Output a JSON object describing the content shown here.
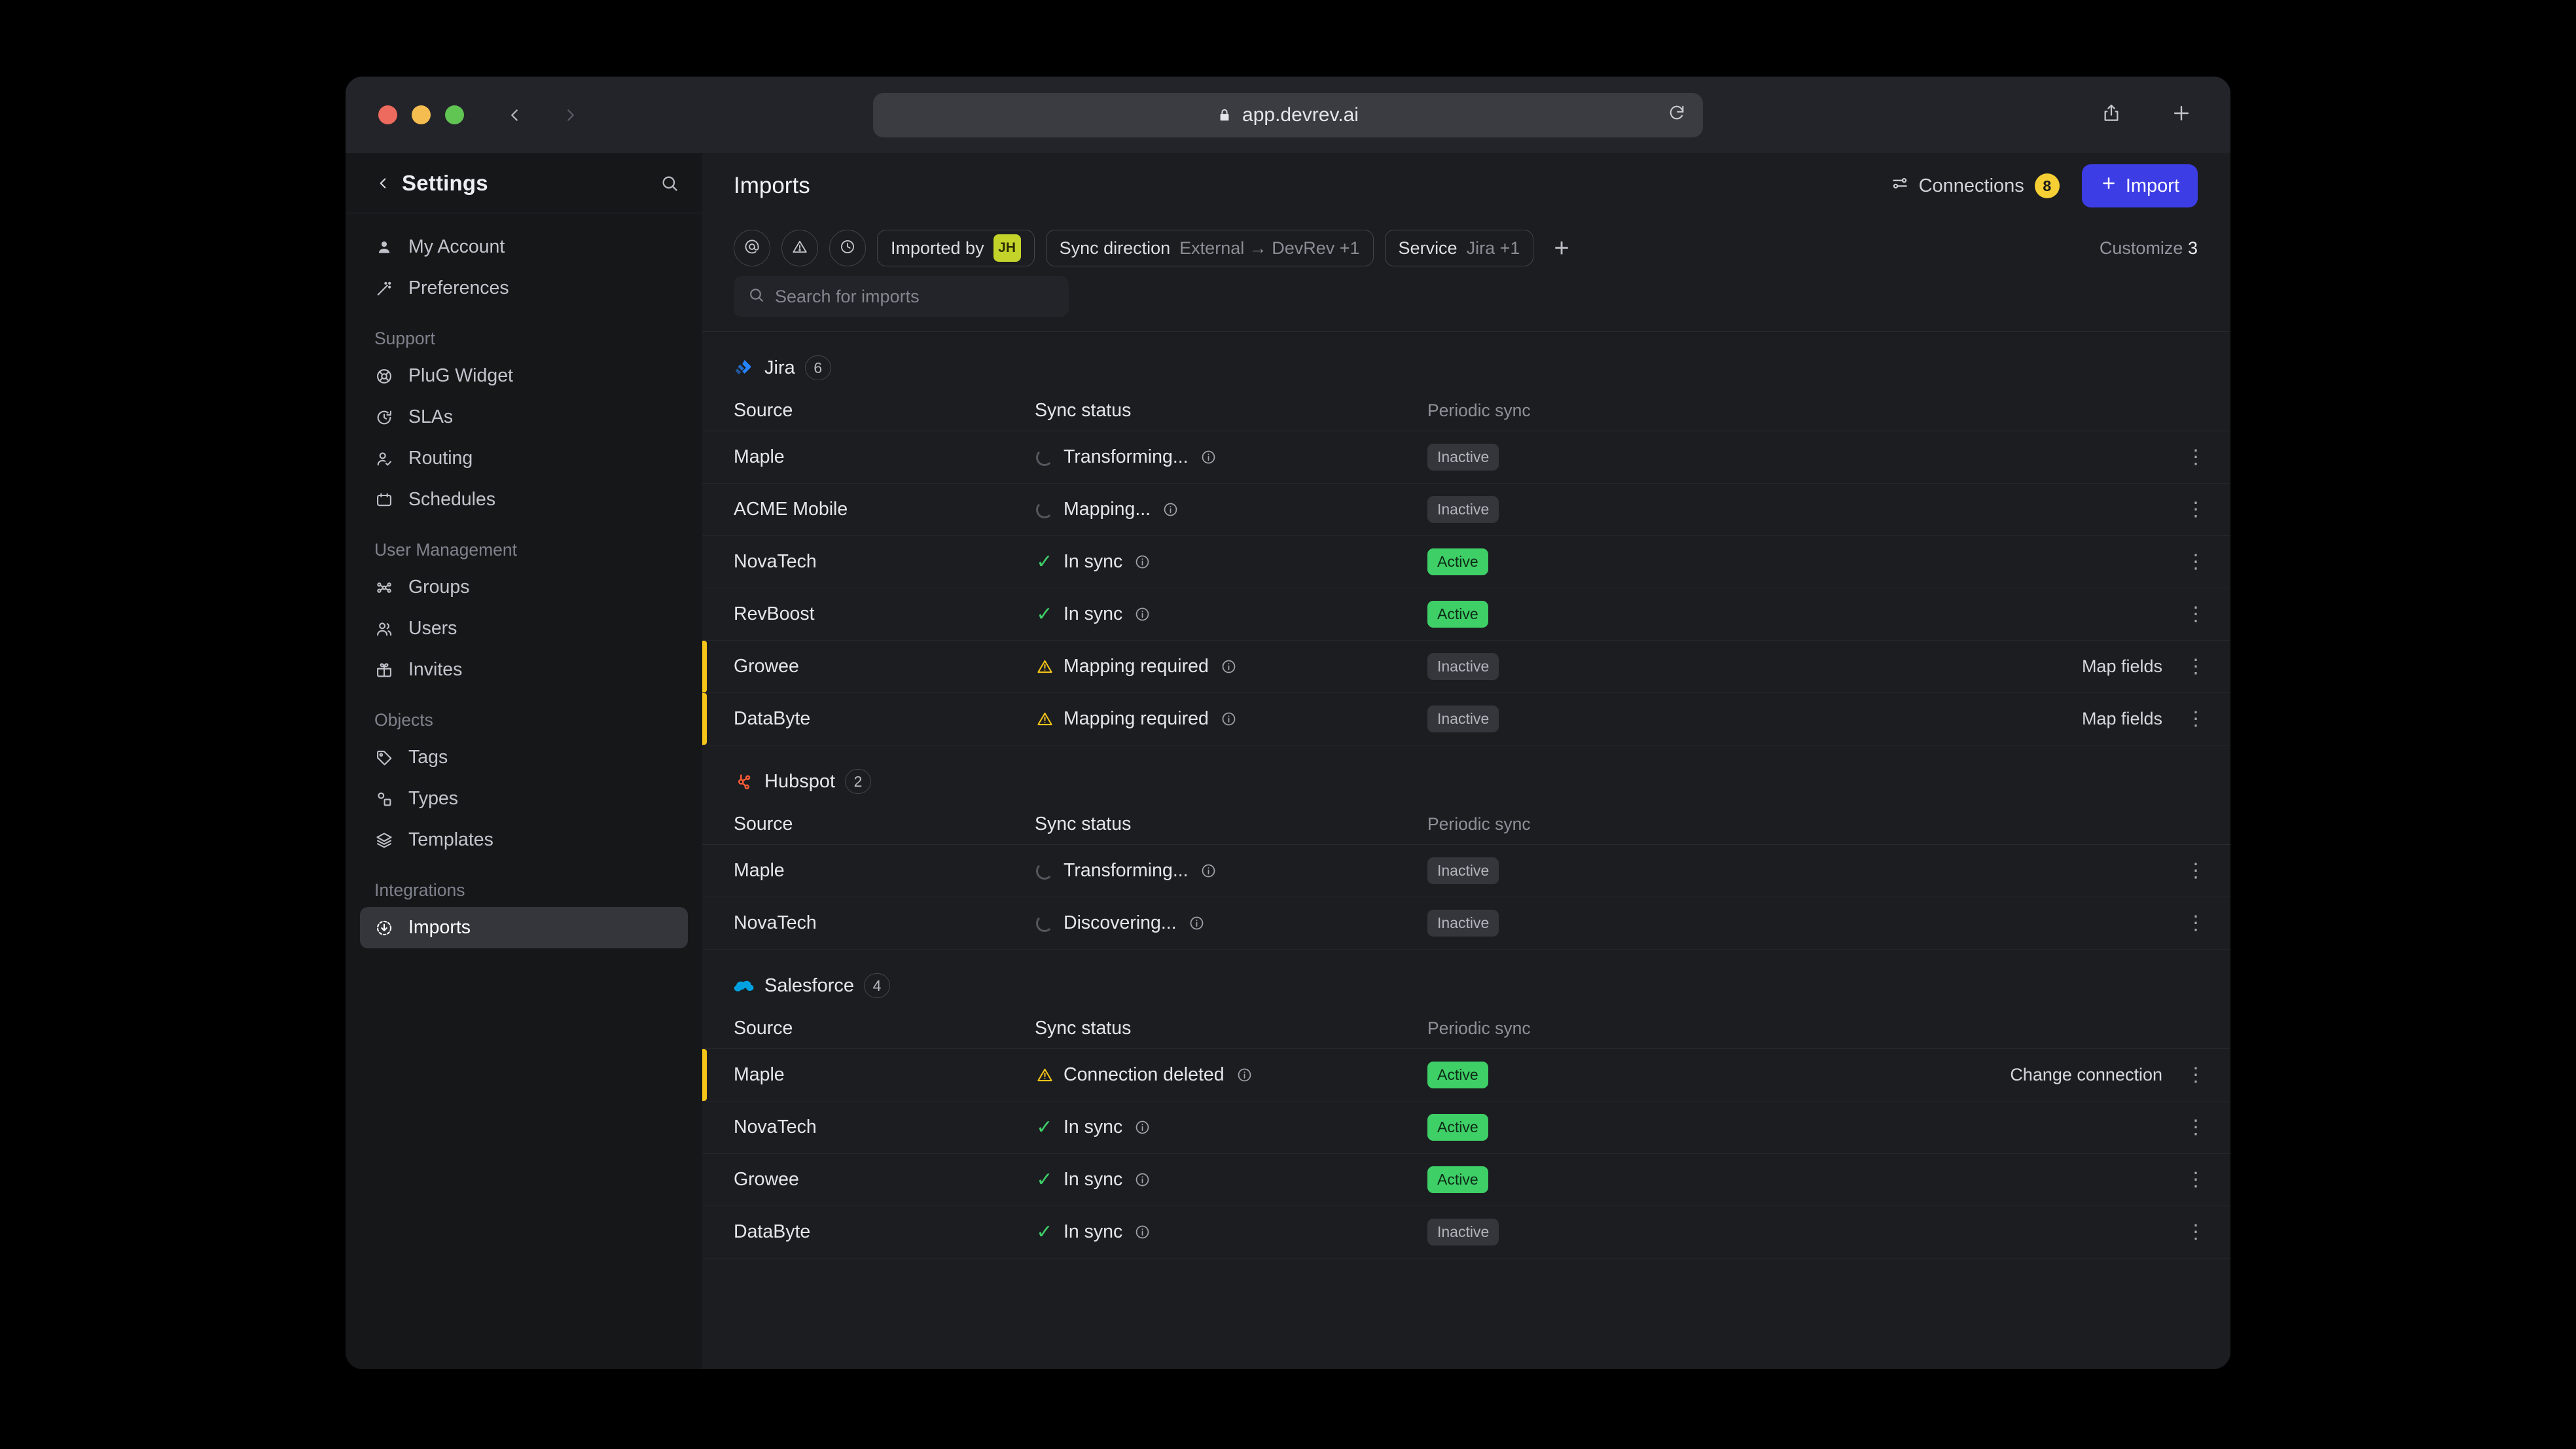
{
  "browser": {
    "url": "app.devrev.ai",
    "lock_icon": "lock-icon",
    "reload_icon": "reload-icon",
    "back_icon": "back-arrow-icon",
    "forward_icon": "forward-arrow-icon",
    "share_icon": "share-icon",
    "newtab_icon": "plus-icon"
  },
  "sidebar": {
    "title": "Settings",
    "back_icon": "chevron-left-icon",
    "search_icon": "search-icon",
    "sections": [
      {
        "label": "",
        "items": [
          {
            "label": "My Account",
            "icon": "person-icon",
            "active": false
          },
          {
            "label": "Preferences",
            "icon": "wand-icon",
            "active": false
          }
        ]
      },
      {
        "label": "Support",
        "items": [
          {
            "label": "PluG Widget",
            "icon": "lifebuoy-icon",
            "active": false
          },
          {
            "label": "SLAs",
            "icon": "timer-icon",
            "active": false
          },
          {
            "label": "Routing",
            "icon": "person-check-icon",
            "active": false
          },
          {
            "label": "Schedules",
            "icon": "calendar-icon",
            "active": false
          }
        ]
      },
      {
        "label": "User Management",
        "items": [
          {
            "label": "Groups",
            "icon": "groups-icon",
            "active": false
          },
          {
            "label": "Users",
            "icon": "users-icon",
            "active": false
          },
          {
            "label": "Invites",
            "icon": "gift-icon",
            "active": false
          }
        ]
      },
      {
        "label": "Objects",
        "items": [
          {
            "label": "Tags",
            "icon": "tag-icon",
            "active": false
          },
          {
            "label": "Types",
            "icon": "shapes-icon",
            "active": false
          },
          {
            "label": "Templates",
            "icon": "layers-icon",
            "active": false
          }
        ]
      },
      {
        "label": "Integrations",
        "items": [
          {
            "label": "Imports",
            "icon": "download-circle-icon",
            "active": true
          }
        ]
      }
    ]
  },
  "header": {
    "title": "Imports",
    "connections_label": "Connections",
    "connections_count": "8",
    "connections_icon": "connections-icon",
    "import_label": "Import",
    "import_icon": "plus-icon",
    "import_color": "#3d3de6",
    "badge_color": "#f5cf34"
  },
  "filters": {
    "icon_buttons": [
      {
        "icon": "at-icon"
      },
      {
        "icon": "alert-triangle-icon"
      },
      {
        "icon": "clock-icon"
      }
    ],
    "chips": [
      {
        "label": "Imported by",
        "value": "",
        "avatar": "JH"
      },
      {
        "label": "Sync direction",
        "value": "External → DevRev +1",
        "avatar": ""
      },
      {
        "label": "Service",
        "value": "Jira +1",
        "avatar": ""
      }
    ],
    "add_icon": "plus-icon",
    "customize_label": "Customize",
    "customize_count": "3"
  },
  "search": {
    "placeholder": "Search for imports",
    "value": "",
    "icon": "search-icon"
  },
  "table": {
    "columns": [
      "Source",
      "Sync status",
      "Periodic sync"
    ],
    "groups": [
      {
        "service": "Jira",
        "logo": "jira-logo",
        "count": "6",
        "rows": [
          {
            "source": "Maple",
            "status": "Transforming...",
            "status_icon": "spinner-icon",
            "info_icon": "info-icon",
            "periodic": "Inactive",
            "periodic_state": "inactive",
            "action": "",
            "alert": false
          },
          {
            "source": "ACME Mobile",
            "status": "Mapping...",
            "status_icon": "spinner-icon",
            "info_icon": "info-icon",
            "periodic": "Inactive",
            "periodic_state": "inactive",
            "action": "",
            "alert": false
          },
          {
            "source": "NovaTech",
            "status": "In sync",
            "status_icon": "check-icon",
            "info_icon": "info-icon",
            "periodic": "Active",
            "periodic_state": "active",
            "action": "",
            "alert": false
          },
          {
            "source": "RevBoost",
            "status": "In sync",
            "status_icon": "check-icon",
            "info_icon": "info-icon",
            "periodic": "Active",
            "periodic_state": "active",
            "action": "",
            "alert": false
          },
          {
            "source": "Growee",
            "status": "Mapping required",
            "status_icon": "warning-icon",
            "info_icon": "info-icon",
            "periodic": "Inactive",
            "periodic_state": "inactive",
            "action": "Map fields",
            "alert": true
          },
          {
            "source": "DataByte",
            "status": "Mapping required",
            "status_icon": "warning-icon",
            "info_icon": "info-icon",
            "periodic": "Inactive",
            "periodic_state": "inactive",
            "action": "Map fields",
            "alert": true
          }
        ]
      },
      {
        "service": "Hubspot",
        "logo": "hubspot-logo",
        "count": "2",
        "rows": [
          {
            "source": "Maple",
            "status": "Transforming...",
            "status_icon": "spinner-icon",
            "info_icon": "info-icon",
            "periodic": "Inactive",
            "periodic_state": "inactive",
            "action": "",
            "alert": false
          },
          {
            "source": "NovaTech",
            "status": "Discovering...",
            "status_icon": "spinner-icon",
            "info_icon": "info-icon",
            "periodic": "Inactive",
            "periodic_state": "inactive",
            "action": "",
            "alert": false
          }
        ]
      },
      {
        "service": "Salesforce",
        "logo": "salesforce-logo",
        "count": "4",
        "rows": [
          {
            "source": "Maple",
            "status": "Connection deleted",
            "status_icon": "warning-icon",
            "info_icon": "info-icon",
            "periodic": "Active",
            "periodic_state": "active",
            "action": "Change connection",
            "alert": true
          },
          {
            "source": "NovaTech",
            "status": "In sync",
            "status_icon": "check-icon",
            "info_icon": "info-icon",
            "periodic": "Active",
            "periodic_state": "active",
            "action": "",
            "alert": false
          },
          {
            "source": "Growee",
            "status": "In sync",
            "status_icon": "check-icon",
            "info_icon": "info-icon",
            "periodic": "Active",
            "periodic_state": "active",
            "action": "",
            "alert": false
          },
          {
            "source": "DataByte",
            "status": "In sync",
            "status_icon": "check-icon",
            "info_icon": "info-icon",
            "periodic": "Inactive",
            "periodic_state": "inactive",
            "action": "",
            "alert": false
          }
        ]
      }
    ],
    "kebab_icon": "more-vertical-icon",
    "accent_color": "#f5c518"
  }
}
